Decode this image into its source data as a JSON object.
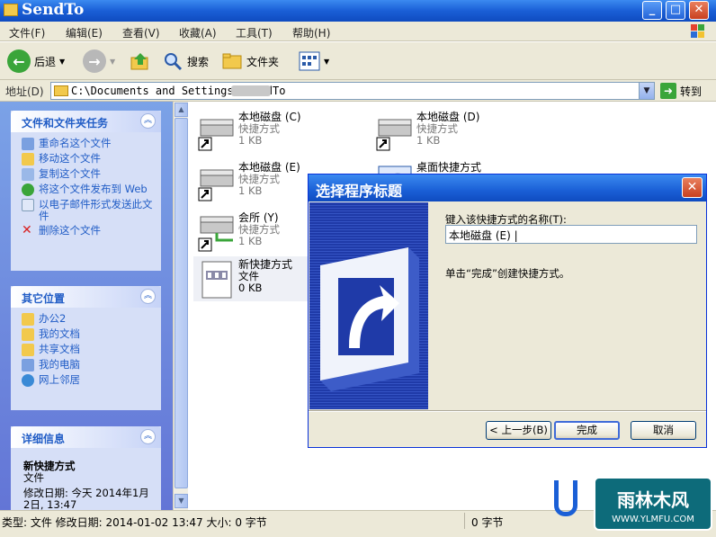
{
  "window": {
    "title": "SendTo",
    "min": "_",
    "max": "□",
    "close": "✕"
  },
  "menu": [
    "文件(F)",
    "编辑(E)",
    "查看(V)",
    "收藏(A)",
    "工具(T)",
    "帮助(H)"
  ],
  "toolbar": {
    "back": "后退",
    "search": "搜索",
    "folders": "文件夹"
  },
  "address": {
    "label": "地址(D)",
    "value": "C:\\Documents and Settings      \\SendTo",
    "go": "转到"
  },
  "tasks": {
    "title": "文件和文件夹任务",
    "items": [
      "重命名这个文件",
      "移动这个文件",
      "复制这个文件",
      "将这个文件发布到 Web",
      "以电子邮件形式发送此文件",
      "删除这个文件"
    ]
  },
  "places": {
    "title": "其它位置",
    "items": [
      "办公2",
      "我的文档",
      "共享文档",
      "我的电脑",
      "网上邻居"
    ]
  },
  "details": {
    "title": "详细信息",
    "name": "新快捷方式",
    "type": "文件",
    "modified": "修改日期: 今天 2014年1月2日, 13:47"
  },
  "files": [
    {
      "name": "本地磁盘 (C)",
      "type": "快捷方式",
      "size": "1 KB"
    },
    {
      "name": "本地磁盘 (D)",
      "type": "快捷方式",
      "size": "1 KB"
    },
    {
      "name": "本地磁盘 (E)",
      "type": "快捷方式",
      "size": "1 KB"
    },
    {
      "name": "桌面快捷方式",
      "type": "",
      "size": ""
    },
    {
      "name": "会所 (Y)",
      "type": "快捷方式",
      "size": "1 KB"
    },
    {
      "name": "新快捷方式",
      "type": "文件",
      "size": "0 KB"
    }
  ],
  "status": {
    "left": "类型: 文件 修改日期: 2014-01-02 13:47 大小: 0 字节",
    "right": "0 字节"
  },
  "dialog": {
    "title": "选择程序标题",
    "label": "键入该快捷方式的名称(T):",
    "value": "本地磁盘 (E) |",
    "hint": "单击“完成”创建快捷方式。",
    "back": "< 上一步(B)",
    "finish": "完成",
    "cancel": "取消"
  },
  "watermark": {
    "brand": "雨林木风",
    "url": "WWW.YLMFU.COM"
  }
}
